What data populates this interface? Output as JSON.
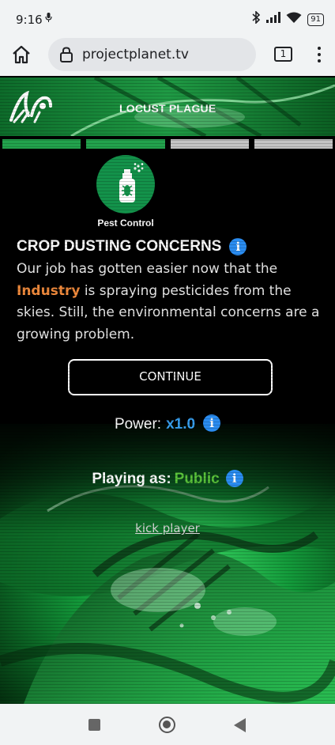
{
  "status_bar": {
    "time": "9:16",
    "battery": "91",
    "icons": [
      "microphone-icon",
      "bluetooth-icon",
      "signal-icon",
      "wifi-icon",
      "battery-icon"
    ]
  },
  "browser": {
    "url": "projectplanet.tv",
    "tab_count": "1",
    "icons": [
      "home-icon",
      "lock-icon",
      "tabs-icon",
      "more-menu-icon"
    ]
  },
  "banner": {
    "title": "LOCUST PLAGUE"
  },
  "progress": {
    "segments": [
      true,
      true,
      false,
      false
    ],
    "colors": {
      "done": "#22a24c",
      "pending": "#c4c4c4"
    }
  },
  "card": {
    "icon": "pesticide-spray-icon",
    "label": "Pest Control",
    "heading": "CROP DUSTING CONCERNS",
    "body_before": "Our job has gotten easier now that the ",
    "body_highlight": "Industry",
    "body_after": " is spraying pesticides from the skies. Still, the environmental concerns are a growing problem."
  },
  "actions": {
    "continue_label": "CONTINUE",
    "kick_label": "kick player"
  },
  "stats": {
    "power_label": "Power:",
    "power_value": "x1.0",
    "playing_label": "Playing as:",
    "playing_value": "Public"
  },
  "colors": {
    "accent_green": "#13924a",
    "info_blue": "#2a8cf0",
    "industry_orange": "#f08a3c",
    "public_green": "#59c23a"
  }
}
